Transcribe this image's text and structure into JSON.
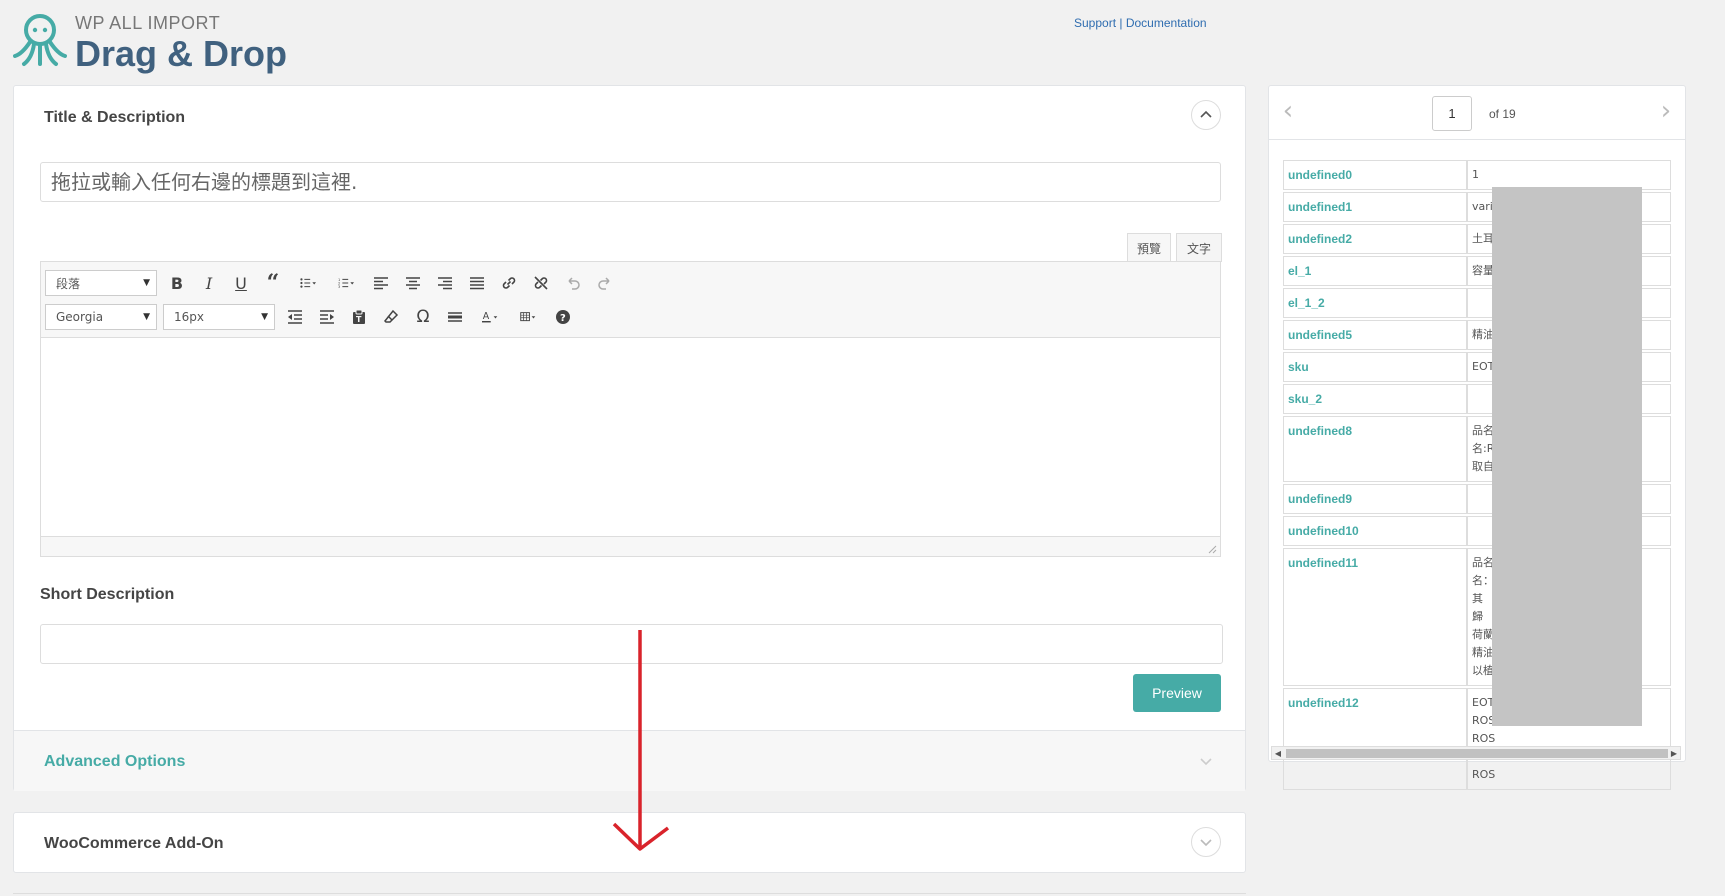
{
  "header": {
    "brand_sub": "WP ALL IMPORT",
    "brand_title": "Drag & Drop",
    "support_link": "Support",
    "separator": "|",
    "documentation_link": "Documentation"
  },
  "title_section": {
    "title": "Title & Description",
    "title_placeholder": "拖拉或輸入任何右邊的標題到這裡."
  },
  "editor": {
    "tab_visual": "預覽",
    "tab_text": "文字",
    "format_select": "段落",
    "font_select": "Georgia",
    "size_select": "16px"
  },
  "short_description": {
    "label": "Short Description"
  },
  "preview_button": "Preview",
  "advanced_options": "Advanced Options",
  "woocommerce_addon": "WooCommerce Add-On",
  "pager": {
    "current": "1",
    "of_label": "of 19"
  },
  "records": [
    {
      "key": "undefined0",
      "value": "1"
    },
    {
      "key": "undefined1",
      "value": "vari"
    },
    {
      "key": "undefined2",
      "value": "土耳"
    },
    {
      "key": "el_1",
      "value": "容量"
    },
    {
      "key": "el_1_2",
      "value": ""
    },
    {
      "key": "undefined5",
      "value": "精油"
    },
    {
      "key": "sku",
      "value": "EOT"
    },
    {
      "key": "sku_2",
      "value": ""
    },
    {
      "key": "undefined8",
      "value": "品名\n名:R\n取自"
    },
    {
      "key": "undefined9",
      "value": ""
    },
    {
      "key": "undefined10",
      "value": ""
    },
    {
      "key": "undefined11",
      "value": "品名\n名：\n其\n歸\n荷蘭\n精油\n以植"
    },
    {
      "key": "undefined12",
      "value": "EOT\nROS\nROS\nROS\nROS"
    }
  ],
  "colors": {
    "accent": "#46aba6",
    "brand": "#40617f",
    "link": "#2f6db0",
    "annotation_arrow": "#d9232b"
  }
}
